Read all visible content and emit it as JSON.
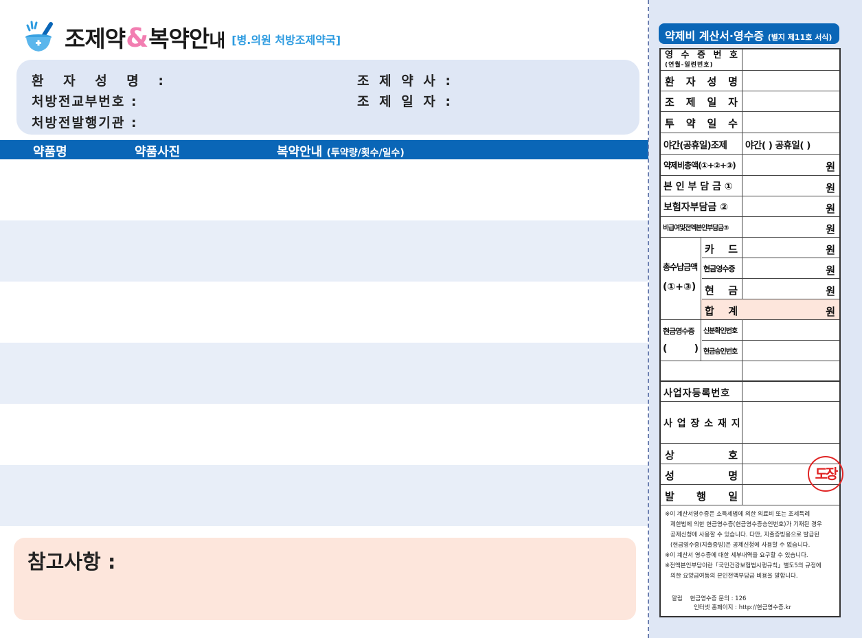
{
  "header": {
    "title_part1": "조제약",
    "title_amp": "&",
    "title_part2": "복약안",
    "title_tail": "내",
    "subtitle": "[병.의원 처방조제약국]"
  },
  "patient": {
    "name_label": "환 자 성 명 :",
    "rx_number_label": "처방전교부번호 :",
    "rx_issuer_label": "처방전발행기관 :",
    "pharmacist_label": "조 제 약 사 :",
    "dispense_date_label": "조 제 일 자 :"
  },
  "medication_table": {
    "col_name": "약품명",
    "col_photo": "약품사진",
    "col_guide": "복약안내",
    "col_guide_note": "(투약량/횟수/일수)"
  },
  "notes": {
    "label": "참고사항 :"
  },
  "receipt": {
    "title": "약제비 계산서·영수증",
    "form_no": "(별지 제11호 서식)",
    "receipt_no_chars": [
      "영",
      "수",
      "증",
      "번",
      "호"
    ],
    "receipt_no_sub": "(연월-일련번호)",
    "patient_name_chars": [
      "환",
      "자",
      "성",
      "명"
    ],
    "dispense_date_chars": [
      "조",
      "제",
      "일",
      "자"
    ],
    "dosage_days_chars": [
      "투",
      "약",
      "일",
      "수"
    ],
    "night_label": "야간(공휴일)조제",
    "night_value": "야간(  ) 공휴일(  )",
    "total_label": "약제비총액(①+②+③)",
    "self_pay_label": "본 인 부 담 금 ①",
    "insurer_label": "보험자부담금 ②",
    "non_covered_label": "비급여및전액본인부담금③",
    "total_paid_label": "총수납금액",
    "total_paid_formula": "(①+③)",
    "card_chars": [
      "카",
      "드"
    ],
    "cash_receipt_label": "현금영수증",
    "cash_chars": [
      "현",
      "금"
    ],
    "sum_chars": [
      "합",
      "계"
    ],
    "won": "원",
    "cash_receipt_group_label": "현금영수증",
    "cash_receipt_group_paren_open": "(",
    "cash_receipt_group_paren_close": ")",
    "identity_no_label": "신분확인번호",
    "approval_no_label": "현금승인번호",
    "business_reg_label": "사업자등록번호",
    "business_addr_label": "사 업 장 소 재 지",
    "company_chars": [
      "상",
      "호"
    ],
    "name_chars": [
      "성",
      "명"
    ],
    "issue_date_chars": [
      "발",
      "행",
      "일"
    ],
    "stamp": "도장",
    "footnotes": [
      "※이 계산서영수증은 소득세법에 의한 의료비 또는 조세특례",
      "제한법에 의한 현금영수증(현금영수증승인번호)가 기재된 경우",
      "공제신청에 사용할 수 있습니다. 다만, 지출증빙용으로 발급된",
      "(현금영수증(지출증빙)은 공제신청에 사용할 수 없습니다.",
      "※이 계산서 영수증에 대한 세부내역을 요구할 수 있습니다.",
      "※전액본인부담이란「국민건강보험법시행규칙」별도5의 규정에",
      "의한 요양급여등의 본인전액부담금 비용을 말합니다."
    ],
    "contact_label": "알림",
    "contact_phone": "현금영수증 문의 : 126",
    "contact_web": "인터넷 홈페이지 : http://현금영수증.kr"
  },
  "colors": {
    "brand_blue": "#0a66b7",
    "light_blue": "#dfe7f5",
    "pink": "#f27eb1",
    "peach": "#fde6dc",
    "stamp_red": "#e02424"
  }
}
